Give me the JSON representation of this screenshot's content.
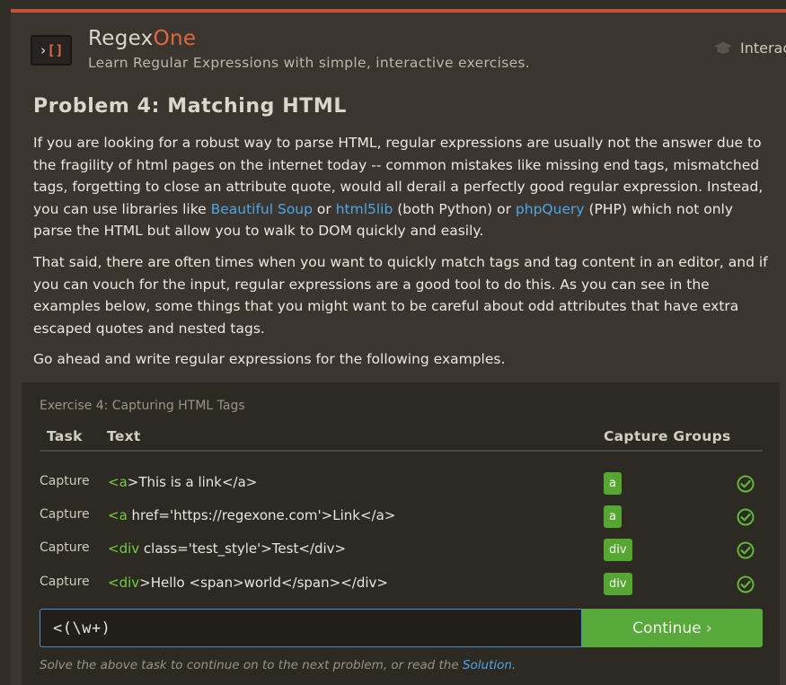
{
  "header": {
    "brand_main": "Regex",
    "brand_accent": "One",
    "tagline": "Learn Regular Expressions with simple, interactive exercises.",
    "nav_interactive": "Interac",
    "logo_text": "[]",
    "logo_arrow": "›"
  },
  "problem": {
    "title": "Problem 4: Matching HTML",
    "p1_a": "If you are looking for a robust way to parse HTML, regular expressions are usually not the answer due to the fragility of html pages on the internet today -- common mistakes like missing end tags, mismatched tags, forgetting to close an attribute quote, would all derail a perfectly good regular expression. Instead, you can use libraries like ",
    "p1_link1": "Beautiful Soup",
    "p1_b": " or ",
    "p1_link2": "html5lib",
    "p1_c": " (both Python) or ",
    "p1_link3": "phpQuery",
    "p1_d": " (PHP) which not only parse the HTML but allow you to walk to DOM quickly and easily.",
    "p2": "That said, there are often times when you want to quickly match tags and tag content in an editor, and if you can vouch for the input, regular expressions are a good tool to do this. As you can see in the examples below, some things that you might want to be careful about odd attributes that have extra escaped quotes and nested tags.",
    "p3": "Go ahead and write regular expressions for the following examples."
  },
  "exercise": {
    "title": "Exercise 4: Capturing HTML Tags",
    "headers": {
      "task": "Task",
      "text": "Text",
      "capture_groups": "Capture Groups"
    },
    "rows": [
      {
        "task": "Capture",
        "match": "<a",
        "rest": ">This is a link</a>",
        "group": "a",
        "status": "matched"
      },
      {
        "task": "Capture",
        "match": "<a",
        "rest": " href='https://regexone.com'>Link</a>",
        "group": "a",
        "status": "matched"
      },
      {
        "task": "Capture",
        "match": "<div",
        "rest": " class='test_style'>Test</div>",
        "group": "div",
        "status": "matched"
      },
      {
        "task": "Capture",
        "match": "<div",
        "rest": ">Hello <span>world</span></div>",
        "group": "div",
        "status": "matched"
      }
    ],
    "input_value": "<(\\w+)",
    "continue_label": "Continue ›",
    "hint_text": "Solve the above task to continue on to the next problem, or read the ",
    "hint_link": "Solution",
    "hint_end": "."
  },
  "colors": {
    "background": "#302c26",
    "accent": "#e0673f",
    "match_green": "#6fcf3a",
    "badge_green": "#56a632",
    "link_blue": "#4ea6e6"
  }
}
